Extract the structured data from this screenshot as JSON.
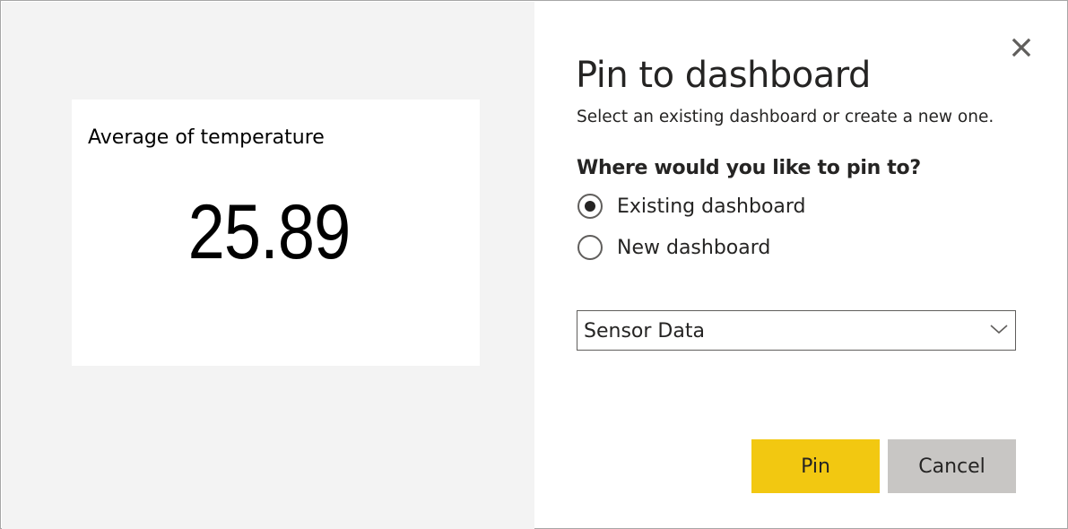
{
  "tile": {
    "title": "Average of temperature",
    "value": "25.89"
  },
  "dialog": {
    "title": "Pin to dashboard",
    "subtitle": "Select an existing dashboard or create a new one.",
    "question": "Where would you like to pin to?",
    "options": [
      {
        "label": "Existing dashboard",
        "checked": true
      },
      {
        "label": "New dashboard",
        "checked": false
      }
    ],
    "dashboard_select": {
      "selected": "Sensor Data"
    },
    "buttons": {
      "pin": "Pin",
      "cancel": "Cancel"
    },
    "close_icon": "close-icon"
  },
  "colors": {
    "pin_button": "#f2c811",
    "cancel_button": "#c8c6c4",
    "preview_background": "#f3f3f3"
  }
}
